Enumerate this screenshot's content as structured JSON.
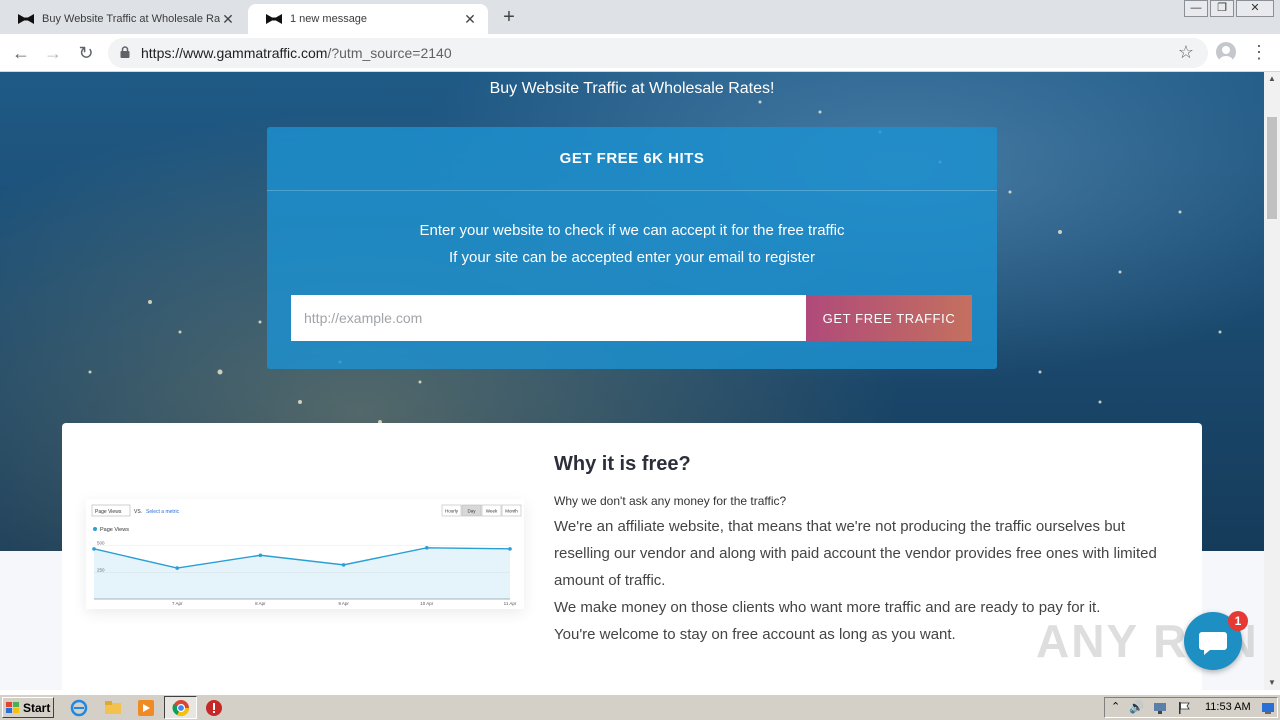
{
  "browser": {
    "tabs": [
      {
        "title": "Buy Website Traffic at Wholesale Ra",
        "active": false
      },
      {
        "title": "1 new message",
        "active": true
      }
    ],
    "url": {
      "host": "https://www.gammatraffic.com",
      "path": "/?utm_source=2140"
    },
    "window_controls": {
      "minimize": "—",
      "restore": "❐",
      "close": "✕"
    }
  },
  "hero": {
    "tagline": "Buy Website Traffic at Wholesale Rates!",
    "card_title": "GET FREE 6K HITS",
    "line1": "Enter your website to check if we can accept it for the free traffic",
    "line2": "If your site can be accepted enter your email to register",
    "input_placeholder": "http://example.com",
    "button_label": "GET FREE TRAFFIC"
  },
  "why": {
    "title": "Why it is free?",
    "subtitle": "Why we don't ask any money for the traffic?",
    "paragraph1": "We're an affiliate website, that means that we're not producing the traffic ourselves but reselling our vendor and along with paid account the vendor provides free ones with limited amount of traffic.",
    "paragraph2": "We make money on those clients who want more traffic and are ready to pay for it.",
    "paragraph3": "You're welcome to stay on free account as long as you want."
  },
  "mini_chart": {
    "metric_select": "Page Views",
    "vs_label": "VS.",
    "select_metric_link": "Select a metric",
    "ranges": [
      "Hourly",
      "Day",
      "Week",
      "Month"
    ],
    "active_range": "Day",
    "legend": "Page Views",
    "y_ticks": [
      "500",
      "250"
    ],
    "x_ticks": [
      "7 Apr",
      "8 Apr",
      "9 Apr",
      "10 Apr",
      "11 Apr"
    ]
  },
  "chart_data": {
    "type": "area",
    "title": "",
    "series": [
      {
        "name": "Page Views",
        "values": [
          470,
          290,
          410,
          320,
          480,
          470
        ]
      }
    ],
    "x": [
      "",
      "7 Apr",
      "8 Apr",
      "9 Apr",
      "10 Apr",
      "11 Apr"
    ],
    "ylim": [
      0,
      600
    ],
    "color": "#2a9fd6"
  },
  "chat": {
    "badge": "1"
  },
  "watermark": "ANY RUN",
  "taskbar": {
    "start_label": "Start",
    "clock": "11:53 AM"
  }
}
